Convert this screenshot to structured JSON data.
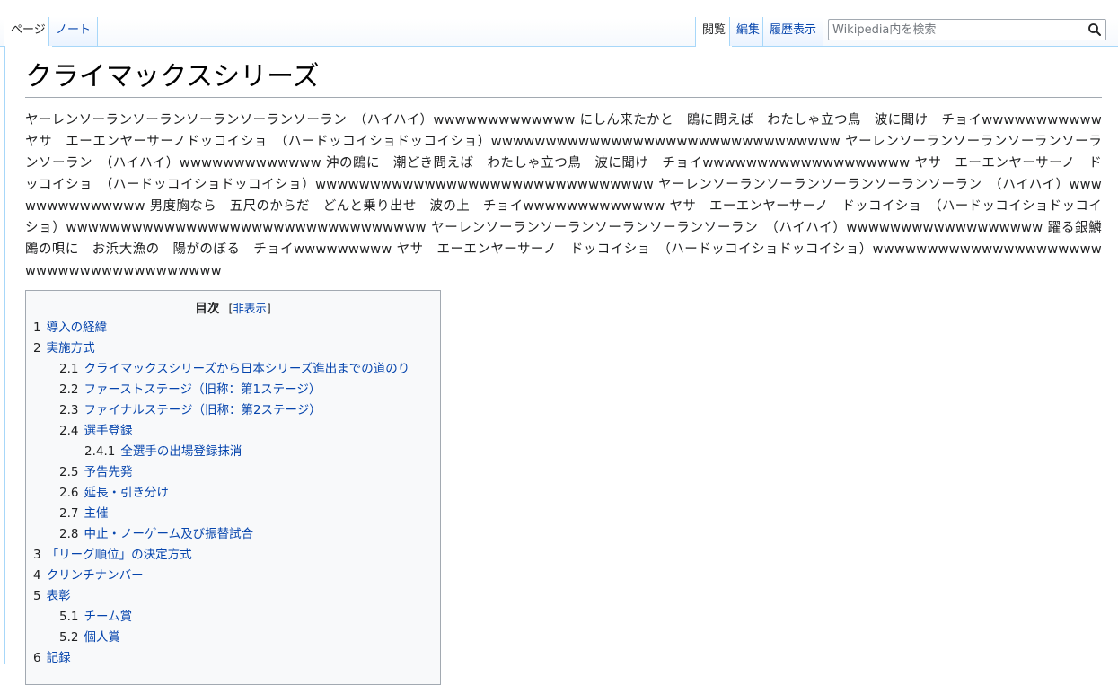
{
  "tabs": {
    "left": [
      {
        "label": "ページ",
        "selected": true
      },
      {
        "label": "ノート",
        "selected": false
      }
    ],
    "right": [
      {
        "label": "閲覧",
        "selected": true
      },
      {
        "label": "編集",
        "selected": false
      },
      {
        "label": "履歴表示",
        "selected": false
      }
    ]
  },
  "search": {
    "placeholder": "Wikipedia内を検索",
    "icon": "search-icon"
  },
  "article": {
    "title": "クライマックスシリーズ",
    "lead": "ヤーレンソーランソーランソーランソーランソーラン　（ハイハイ）wwwwwwwwwwwww にしん来たかと　鴎に問えば　わたしゃ立つ鳥　波に聞け　チョイwwwwwwwwwww ヤサ　エーエンヤーサーノドッコイショ　（ハードッコイショドッコイショ）wwwwwwwwwwwwwwwwwwwwwwwwwwwwwwww ヤーレンソーランソーランソーランソーランソーラン　（ハイハイ）wwwwwwwwwwwww 沖の鴎に　潮どき問えば　わたしゃ立つ鳥　波に聞け　チョイwwwwwwwwwwwwwwwwwww ヤサ　エーエンヤーサーノ　ドッコイショ　（ハードッコイショドッコイショ）wwwwwwwwwwwwwwwwwwwwwwwwwwwwwww ヤーレンソーランソーランソーランソーランソーラン　（ハイハイ）wwwwwwwwwwwwww 男度胸なら　五尺のからだ　どんと乗り出せ　波の上　チョイwwwwwwwwwwwww ヤサ　エーエンヤーサーノ　ドッコイショ　（ハードッコイショドッコイショ）wwwwwwwwwwwwwwwwwwwwwwwwwwwwwwwww ヤーレンソーランソーランソーランソーランソーラン　（ハイハイ）wwwwwwwwwwwwwwwwww 躍る銀鱗　鴎の唄に　お浜大漁の　陽がのぼる　チョイwwwwwwwww ヤサ　エーエンヤーサーノ　ドッコイショ　（ハードッコイショドッコイショ）wwwwwwwwwwwwwwwwwwwwwwwwwwwwwwwwwwwwwww"
  },
  "toc": {
    "title": "目次",
    "toggle_open": "[",
    "toggle_label": "非表示",
    "toggle_close": "]",
    "items": [
      {
        "num": "1",
        "text": "導入の経緯",
        "level": 1
      },
      {
        "num": "2",
        "text": "実施方式",
        "level": 1
      },
      {
        "num": "2.1",
        "text": "クライマックスシリーズから日本シリーズ進出までの道のり",
        "level": 2
      },
      {
        "num": "2.2",
        "text": "ファーストステージ（旧称：第1ステージ）",
        "level": 2
      },
      {
        "num": "2.3",
        "text": "ファイナルステージ（旧称：第2ステージ）",
        "level": 2
      },
      {
        "num": "2.4",
        "text": "選手登録",
        "level": 2
      },
      {
        "num": "2.4.1",
        "text": "全選手の出場登録抹消",
        "level": 3
      },
      {
        "num": "2.5",
        "text": "予告先発",
        "level": 2
      },
      {
        "num": "2.6",
        "text": "延長・引き分け",
        "level": 2
      },
      {
        "num": "2.7",
        "text": "主催",
        "level": 2
      },
      {
        "num": "2.8",
        "text": "中止・ノーゲーム及び振替試合",
        "level": 2
      },
      {
        "num": "3",
        "text": "「リーグ順位」の決定方式",
        "level": 1
      },
      {
        "num": "4",
        "text": "クリンチナンバー",
        "level": 1
      },
      {
        "num": "5",
        "text": "表彰",
        "level": 1
      },
      {
        "num": "5.1",
        "text": "チーム賞",
        "level": 2
      },
      {
        "num": "5.2",
        "text": "個人賞",
        "level": 2
      },
      {
        "num": "6",
        "text": "記録",
        "level": 1
      }
    ]
  },
  "colors": {
    "link": "#0645ad",
    "border": "#a7d7f9",
    "text": "#202122",
    "toc_bg": "#f8f9fa"
  }
}
